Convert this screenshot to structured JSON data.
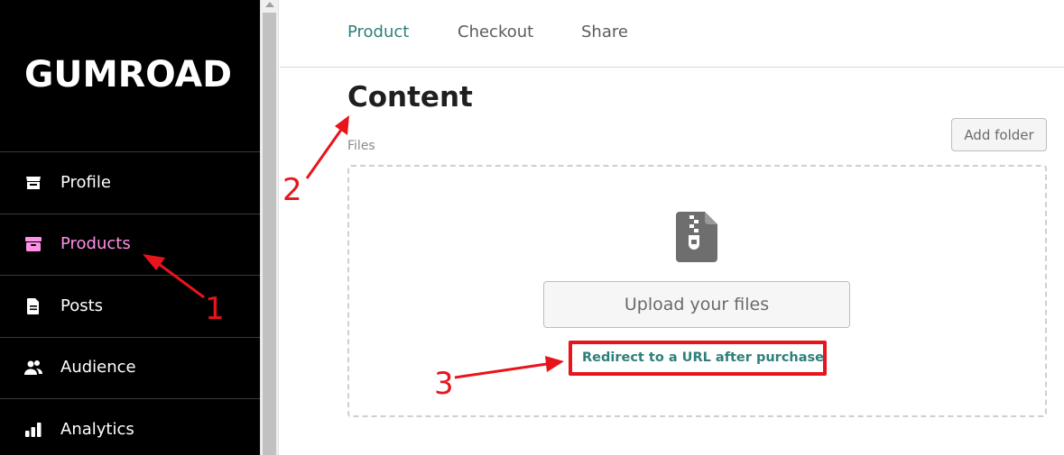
{
  "sidebar": {
    "logo": "GUMROAD",
    "items": [
      {
        "label": "Profile",
        "icon": "store-icon",
        "active": false
      },
      {
        "label": "Products",
        "icon": "archive-box-icon",
        "active": true
      },
      {
        "label": "Posts",
        "icon": "document-icon",
        "active": false
      },
      {
        "label": "Audience",
        "icon": "users-icon",
        "active": false
      },
      {
        "label": "Analytics",
        "icon": "bar-chart-icon",
        "active": false
      }
    ]
  },
  "tabs": [
    {
      "label": "Product",
      "active": true
    },
    {
      "label": "Checkout",
      "active": false
    },
    {
      "label": "Share",
      "active": false
    }
  ],
  "main": {
    "title": "Content",
    "files_label": "Files",
    "add_folder_label": "Add folder",
    "dropzone": {
      "icon": "zip-file-icon",
      "upload_label": "Upload your files",
      "redirect_label": "Redirect to a URL after purchase"
    }
  },
  "annotations": {
    "numbers": [
      "1",
      "2",
      "3"
    ],
    "color": "#e8141b"
  },
  "colors": {
    "sidebar_bg": "#000000",
    "active_nav": "#ff90e8",
    "accent_teal": "#2e7f7b"
  }
}
